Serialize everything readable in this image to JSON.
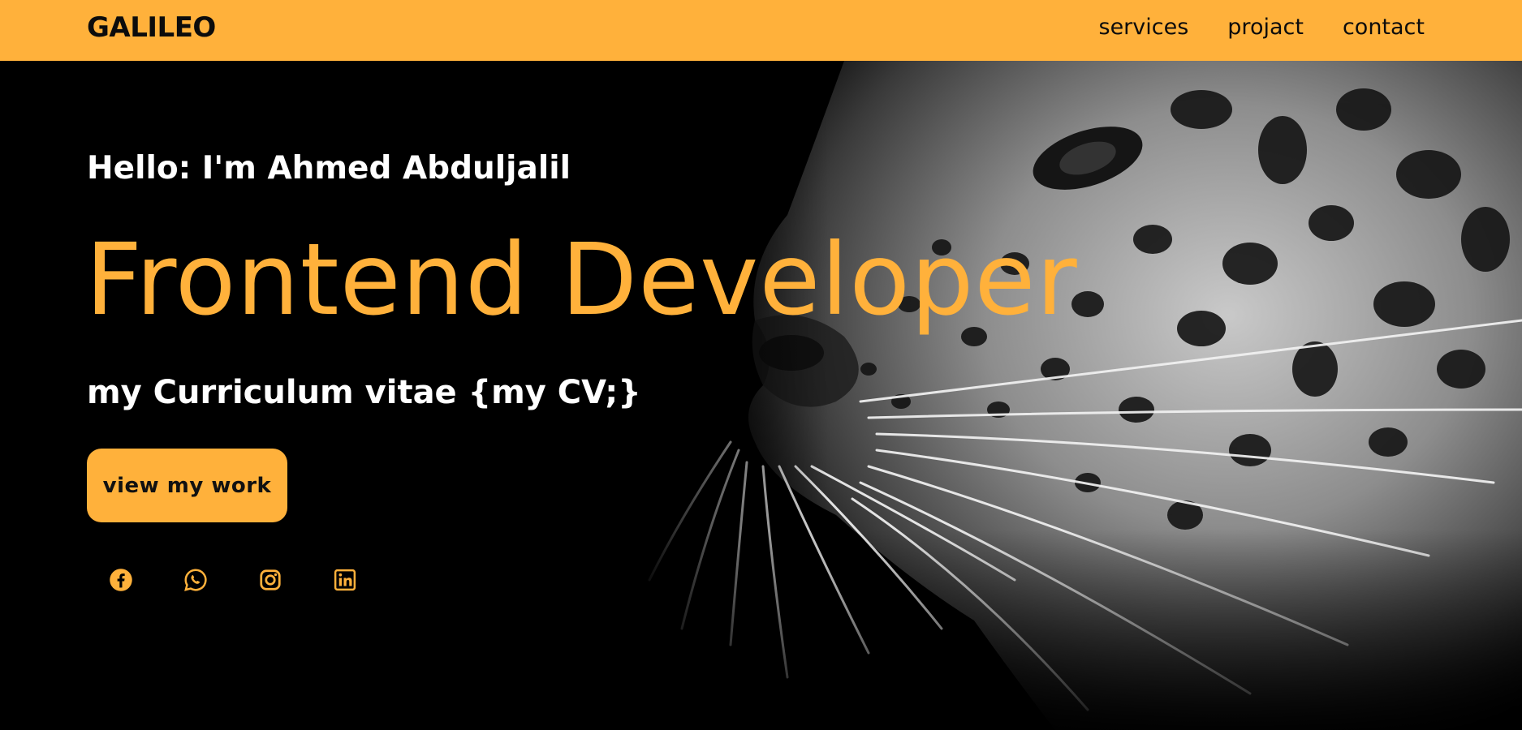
{
  "header": {
    "logo": "GALILEO",
    "nav": [
      "services",
      "projact",
      "contact"
    ]
  },
  "hero": {
    "greeting": "Hello: I'm Ahmed Abduljalil",
    "role": "Frontend Developer",
    "subtitle": "my Curriculum vitae {my CV;}",
    "cta_label": "view my work",
    "socials": [
      "facebook-icon",
      "whatsapp-icon",
      "instagram-icon",
      "linkedin-icon"
    ]
  },
  "theme": {
    "accent": "#ffb13b",
    "background": "#000000",
    "text": "#ffffff"
  }
}
